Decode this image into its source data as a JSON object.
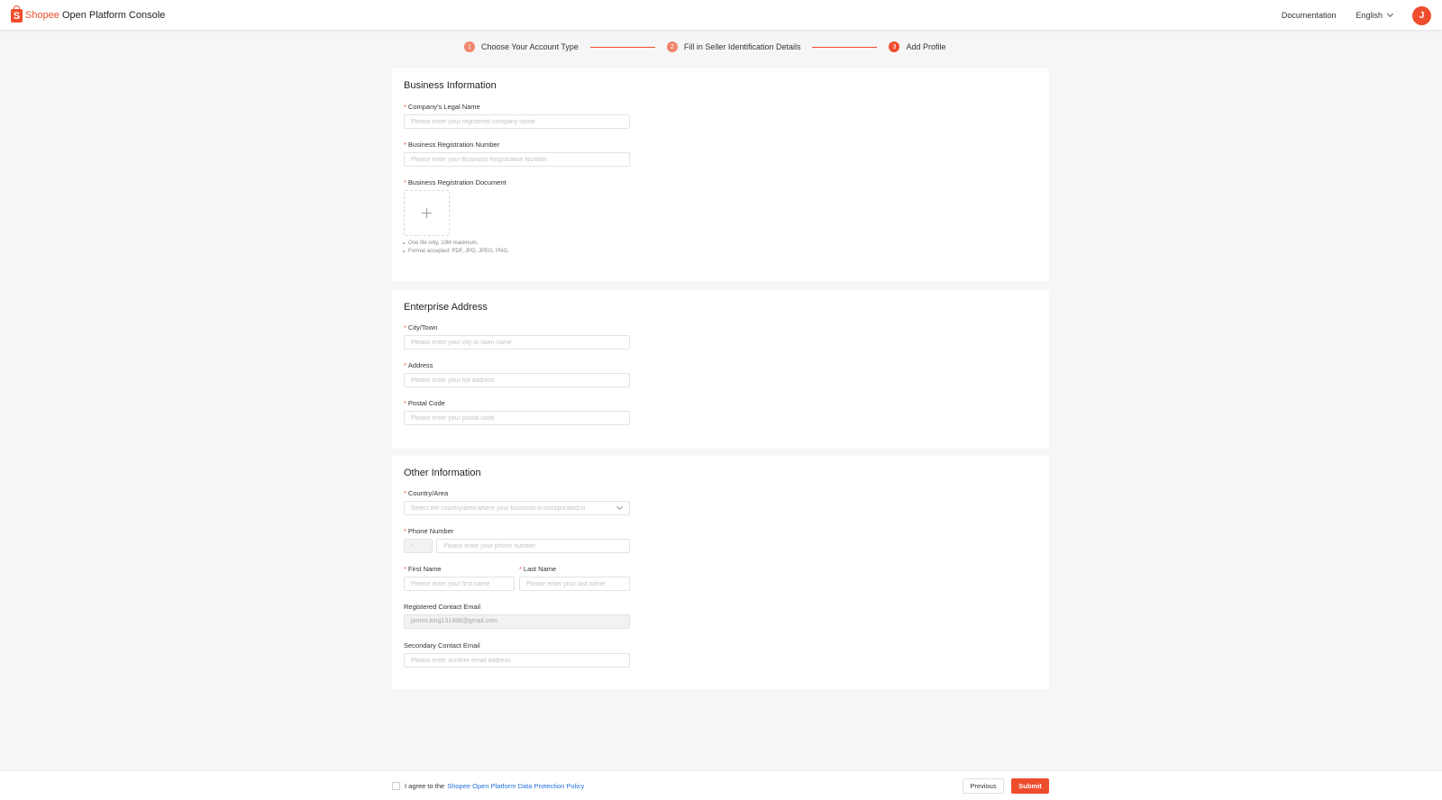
{
  "header": {
    "brand": "Shopee",
    "product": "Open Platform Console",
    "documentation_label": "Documentation",
    "language_label": "English",
    "avatar_initial": "J",
    "accent_color": "#ee4d2d"
  },
  "steps": [
    {
      "number": "1",
      "label": "Choose Your Account Type"
    },
    {
      "number": "2",
      "label": "Fill in Seller Identification Details"
    },
    {
      "number": "3",
      "label": "Add Profile"
    }
  ],
  "business": {
    "title": "Business Information",
    "legal_name_label": "Company's Legal Name",
    "legal_name_placeholder": "Please enter your registered company name",
    "reg_number_label": "Business Registration Number",
    "reg_number_placeholder": "Please enter your Business Registration Number",
    "reg_doc_label": "Business Registration Document",
    "hint_1": "One file only, 10M maximum.",
    "hint_2": "Format accepted: PDF, JPG, JPEG, PNG."
  },
  "address": {
    "title": "Enterprise Address",
    "city_label": "City/Town",
    "city_placeholder": "Please enter your city or town name",
    "address_label": "Address",
    "address_placeholder": "Please enter your full address",
    "postal_label": "Postal Code",
    "postal_placeholder": "Please enter your postal code"
  },
  "other": {
    "title": "Other Information",
    "country_label": "Country/Area",
    "country_placeholder": "Select the country/area where your business is incorporated in",
    "phone_label": "Phone Number",
    "phone_prefix": "-",
    "phone_placeholder": "Please enter your phone number",
    "first_name_label": "First Name",
    "first_name_placeholder": "Please enter your first name",
    "last_name_label": "Last Name",
    "last_name_placeholder": "Please enter your last name",
    "reg_email_label": "Registered Contact Email",
    "reg_email_value": "james.king131488@gmail.com",
    "secondary_email_label": "Secondary Contact Email",
    "secondary_email_placeholder": "Please enter another email address"
  },
  "footer": {
    "agree_text": "I agree to the",
    "policy_link": "Shopee Open Platform Data Protection Policy",
    "previous_label": "Previous",
    "submit_label": "Submit"
  }
}
